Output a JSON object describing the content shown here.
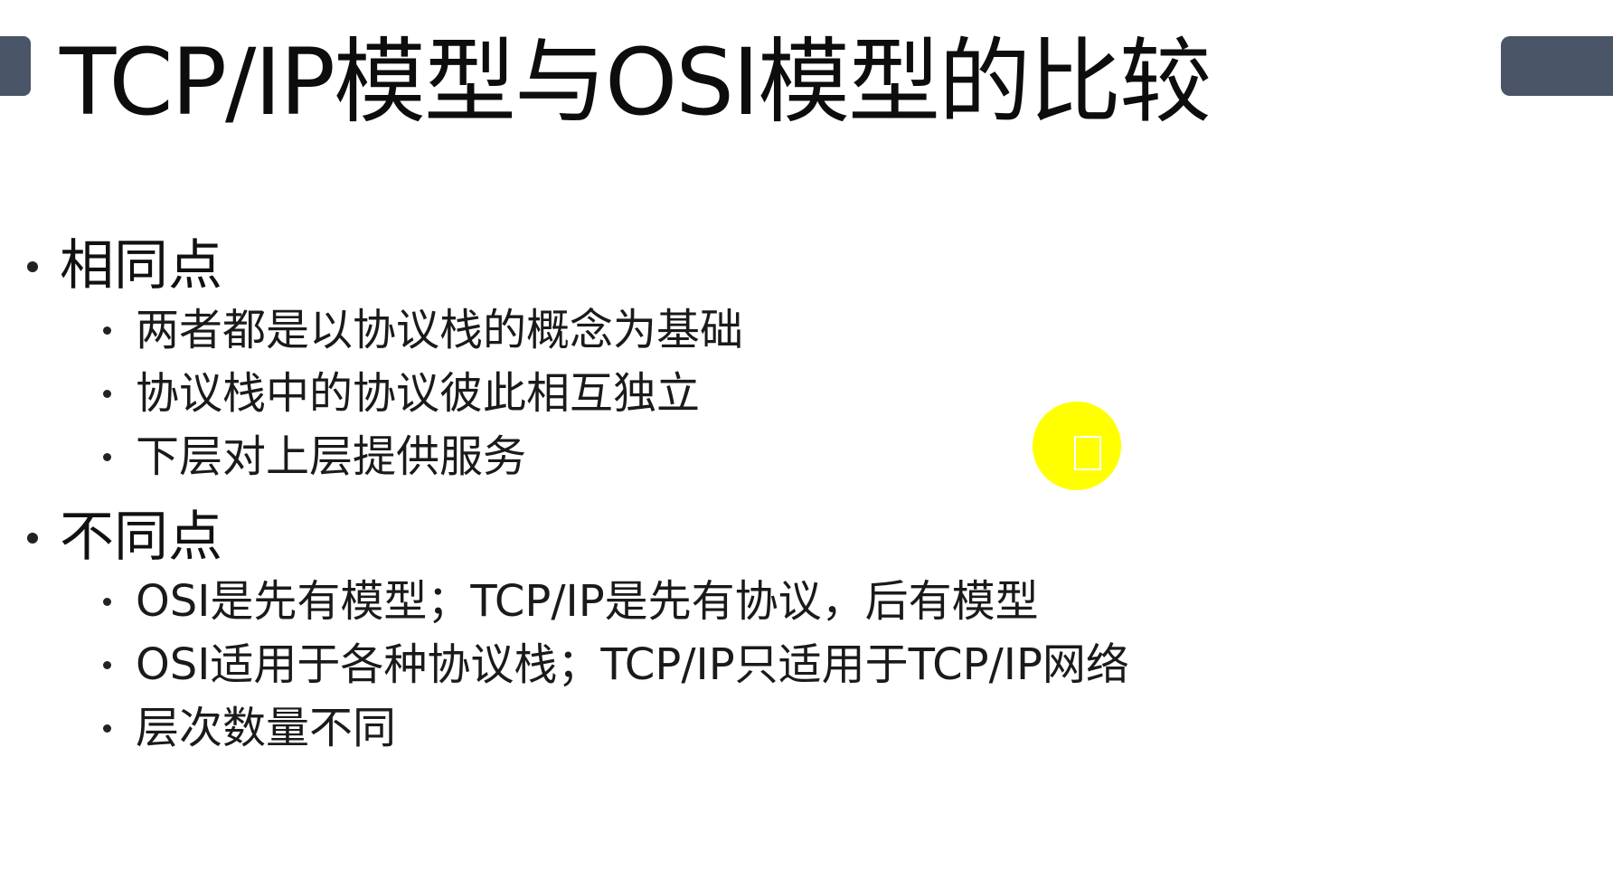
{
  "slide": {
    "title": "TCP/IP模型与OSI模型的比较",
    "sections": [
      {
        "heading": "相同点",
        "items": [
          "两者都是以协议栈的概念为基础",
          "协议栈中的协议彼此相互独立",
          "下层对上层提供服务"
        ]
      },
      {
        "heading": "不同点",
        "items": [
          "OSI是先有模型；TCP/IP是先有协议，后有模型",
          "OSI适用于各种协议栈；TCP/IP只适用于TCP/IP网络",
          "层次数量不同"
        ]
      }
    ]
  },
  "colors": {
    "decor_tab": "#4a5568",
    "cursor_highlight": "#ffff00",
    "text": "#111111"
  }
}
